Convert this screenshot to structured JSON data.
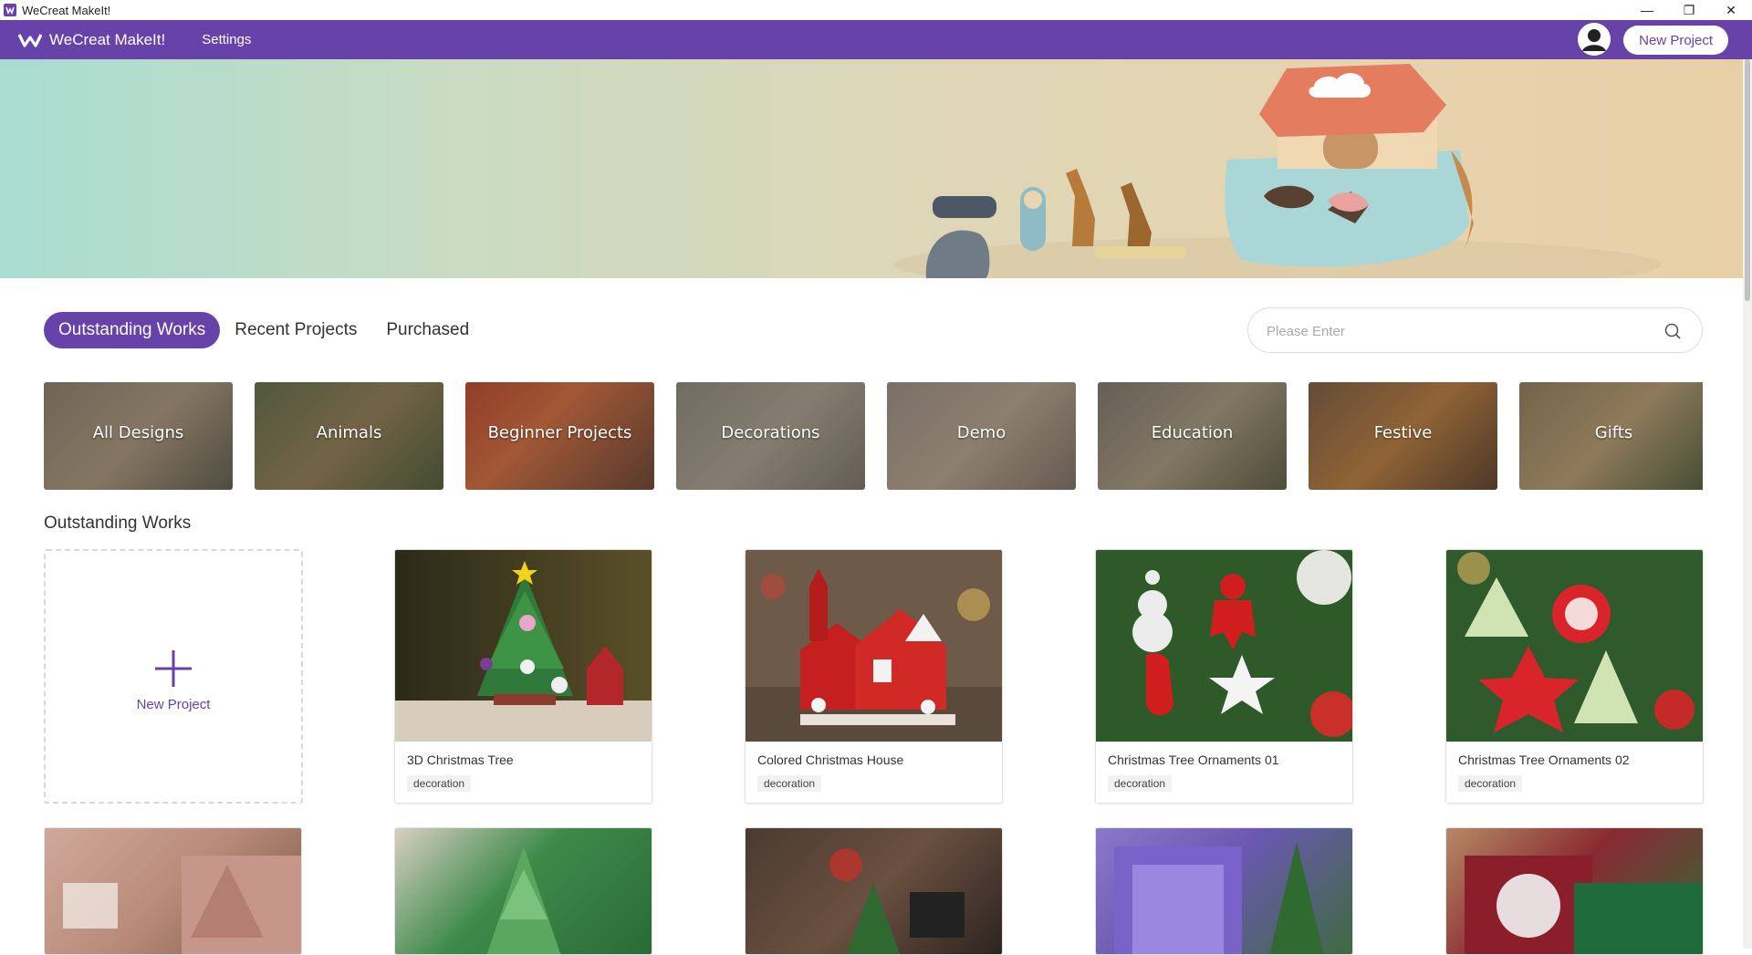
{
  "window": {
    "title": "WeCreat MakeIt!"
  },
  "header": {
    "brand": "WeCreat MakeIt!",
    "settings_label": "Settings",
    "new_project_label": "New Project"
  },
  "tabs": [
    {
      "label": "Outstanding Works",
      "active": true
    },
    {
      "label": "Recent Projects",
      "active": false
    },
    {
      "label": "Purchased",
      "active": false
    }
  ],
  "search": {
    "placeholder": "Please Enter",
    "value": ""
  },
  "categories": [
    {
      "label": "All Designs"
    },
    {
      "label": "Animals"
    },
    {
      "label": "Beginner Projects"
    },
    {
      "label": "Decorations"
    },
    {
      "label": "Demo"
    },
    {
      "label": "Education"
    },
    {
      "label": "Festive"
    },
    {
      "label": "Gifts"
    }
  ],
  "section_title": "Outstanding Works",
  "new_card": {
    "label": "New Project"
  },
  "cards": [
    {
      "title": "3D Christmas Tree",
      "tag": "decoration"
    },
    {
      "title": "Colored Christmas House",
      "tag": "decoration"
    },
    {
      "title": "Christmas Tree Ornaments 01",
      "tag": "decoration"
    },
    {
      "title": "Christmas Tree Ornaments 02",
      "tag": "decoration"
    }
  ],
  "colors": {
    "accent": "#6742a8"
  }
}
